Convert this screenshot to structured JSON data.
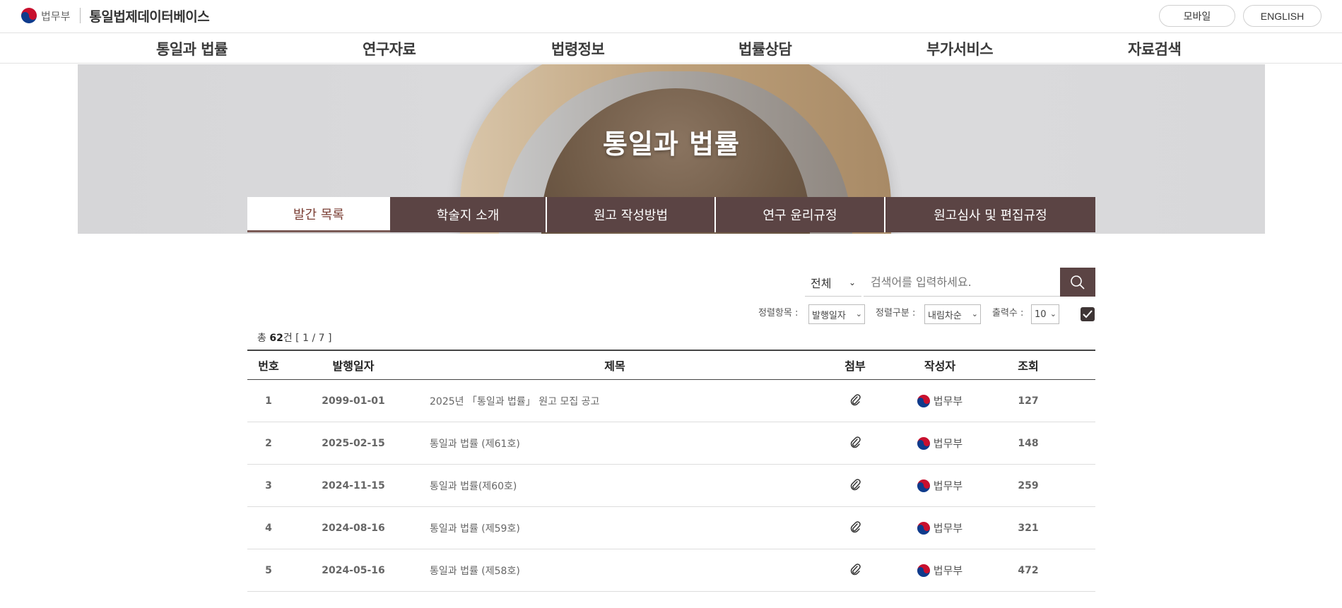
{
  "header": {
    "ministry_label": "법무부",
    "site_title": "통일법제데이터베이스",
    "mobile_button": "모바일",
    "english_button": "ENGLISH"
  },
  "gnb": [
    "통일과 법률",
    "연구자료",
    "법령정보",
    "법률상담",
    "부가서비스",
    "자료검색"
  ],
  "hero": {
    "title": "통일과 법률"
  },
  "subtabs": [
    "발간 목록",
    "학술지 소개",
    "원고 작성방법",
    "연구 윤리규정",
    "원고심사 및 편집규정"
  ],
  "search": {
    "scope": "전체",
    "placeholder": "검색어를 입력하세요.",
    "sort_item_label": "정렬항목 :",
    "sort_item_value": "발행일자",
    "sort_order_label": "정렬구분 :",
    "sort_order_value": "내림차순",
    "page_size_label": "출력수 :",
    "page_size_value": "10"
  },
  "summary": {
    "prefix": "총",
    "count": "62",
    "suffix": "건",
    "paging": "[ 1 / 7 ]"
  },
  "table": {
    "headers": [
      "번호",
      "발행일자",
      "제목",
      "첨부",
      "작성자",
      "조회"
    ],
    "rows": [
      {
        "no": "1",
        "date": "2099-01-01",
        "title": "2025년 「통일과 법률」 원고 모집 공고",
        "author": "법무부",
        "views": "127"
      },
      {
        "no": "2",
        "date": "2025-02-15",
        "title": "통일과 법률 (제61호)",
        "author": "법무부",
        "views": "148"
      },
      {
        "no": "3",
        "date": "2024-11-15",
        "title": "통일과 법률(제60호)",
        "author": "법무부",
        "views": "259"
      },
      {
        "no": "4",
        "date": "2024-08-16",
        "title": "통일과 법률 (제59호)",
        "author": "법무부",
        "views": "321"
      },
      {
        "no": "5",
        "date": "2024-05-16",
        "title": "통일과 법률 (제58호)",
        "author": "법무부",
        "views": "472"
      }
    ]
  },
  "colors": {
    "accent": "#5b4444",
    "active_tab_text": "#7a3d33"
  }
}
